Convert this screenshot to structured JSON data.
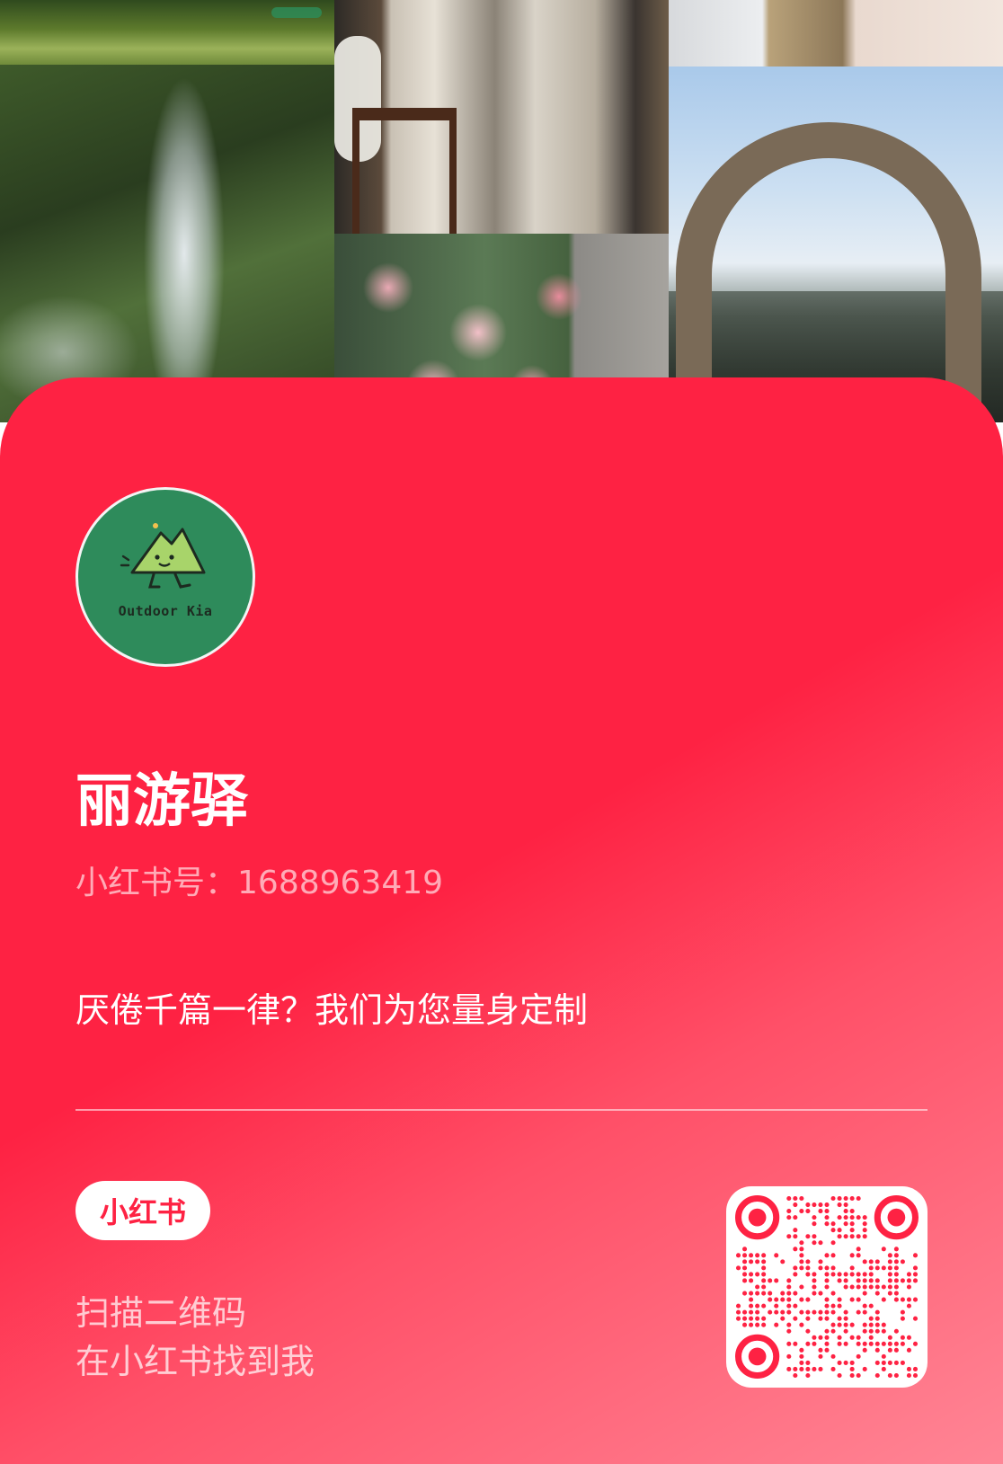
{
  "profile": {
    "display_name": "丽游驿",
    "id_label": "小红书号：",
    "id_value": "1688963419",
    "bio": "厌倦千篇一律？我们为您量身定制",
    "avatar_brand_text": "Outdoor Kia"
  },
  "branding": {
    "app_logo_text": "小红书",
    "accent_color": "#fe2243",
    "avatar_color": "#2e8b5b"
  },
  "cta": {
    "line1": "扫描二维码",
    "line2": "在小红书找到我"
  },
  "collage": {
    "photos": [
      "mossy-rocks",
      "waterfall",
      "old-street-alley",
      "roses",
      "stone-bowls",
      "stone-arch-bridge"
    ]
  }
}
